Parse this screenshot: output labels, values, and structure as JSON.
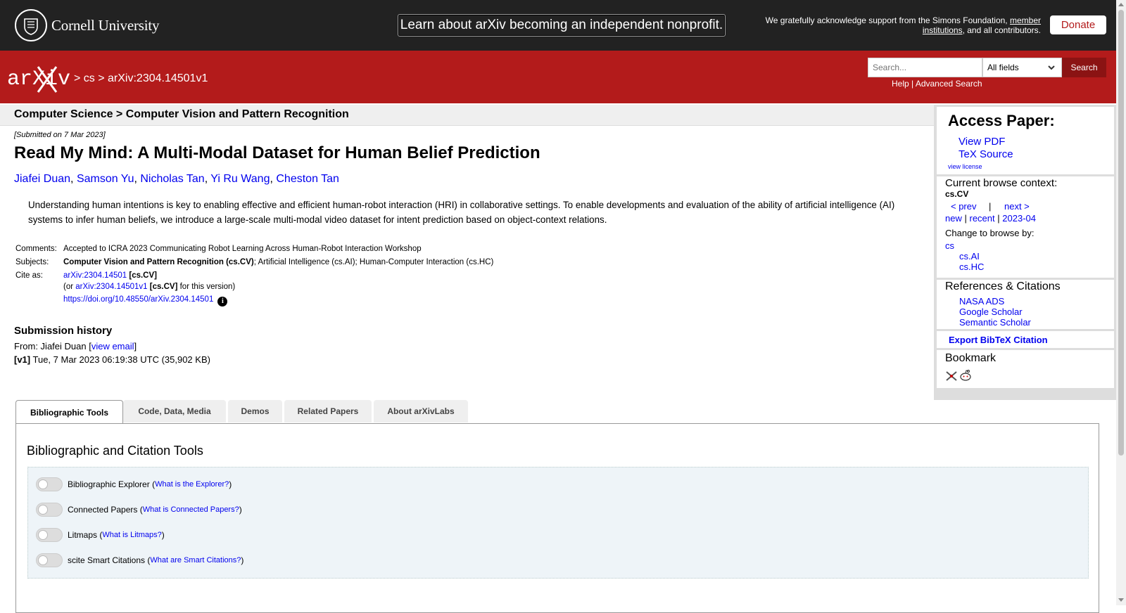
{
  "top": {
    "institution": "Cornell University",
    "banner": "Learn about arXiv becoming an independent nonprofit.",
    "support_prefix": "We gratefully acknowledge support from the Simons Foundation,",
    "support_link": "member institutions",
    "support_suffix": ", and all contributors.",
    "donate": "Donate"
  },
  "header": {
    "logo_text": "arXiv",
    "breadcrumb": "> cs > arXiv:2304.14501v1",
    "search_placeholder": "Search...",
    "field_selected": "All fields",
    "search_button": "Search",
    "help": "Help",
    "separator": "|",
    "advanced": "Advanced Search"
  },
  "subject_header": "Computer Science > Computer Vision and Pattern Recognition",
  "paper": {
    "submitted": "[Submitted on 7 Mar 2023]",
    "title": "Read My Mind: A Multi-Modal Dataset for Human Belief Prediction",
    "authors": [
      "Jiafei Duan",
      "Samson Yu",
      "Nicholas Tan",
      "Yi Ru Wang",
      "Cheston Tan"
    ],
    "abstract": "Understanding human intentions is key to enabling effective and efficient human-robot interaction (HRI) in collaborative settings. To enable developments and evaluation of the ability of artificial intelligence (AI) systems to infer human beliefs, we introduce a large-scale multi-modal video dataset for intent prediction based on object-context relations."
  },
  "meta": {
    "comments_label": "Comments:",
    "comments": "Accepted to ICRA 2023 Communicating Robot Learning Across Human-Robot Interaction Workshop",
    "subjects_label": "Subjects:",
    "subjects_primary": "Computer Vision and Pattern Recognition (cs.CV)",
    "subjects_rest": "; Artificial Intelligence (cs.AI); Human-Computer Interaction (cs.HC)",
    "cite_label": "Cite as:",
    "cite_id": "arXiv:2304.14501",
    "cite_tag": "[cs.CV]",
    "cite_or": "(or",
    "cite_version_id": "arXiv:2304.14501v1",
    "cite_version_tag": "[cs.CV]",
    "cite_version_suffix": "for this version)",
    "doi": "https://doi.org/10.48550/arXiv.2304.14501",
    "info_glyph": "i"
  },
  "history": {
    "title": "Submission history",
    "from_label": "From: Jiafei Duan [",
    "view_email": "view email",
    "from_close": "]",
    "v1_tag": "[v1]",
    "v1_text": "Tue, 7 Mar 2023 06:19:38 UTC (35,902 KB)"
  },
  "sidebar": {
    "access_title": "Access Paper:",
    "view_pdf": "View PDF",
    "tex_source": "TeX Source",
    "view_license": "view license",
    "browse_title": "Current browse context:",
    "browse_context": "cs.CV",
    "prev": "< prev",
    "pipe": "|",
    "next": "next >",
    "new": "new",
    "recent": "recent",
    "month": "2023-04",
    "change_browse": "Change to browse by:",
    "cs": "cs",
    "cs_ai": "cs.AI",
    "cs_hc": "cs.HC",
    "refs_title": "References & Citations",
    "nasa": "NASA ADS",
    "google": "Google Scholar",
    "semantic": "Semantic Scholar",
    "export": "Export BibTeX Citation",
    "bookmark": "Bookmark"
  },
  "tabs": [
    "Bibliographic Tools",
    "Code, Data, Media",
    "Demos",
    "Related Papers",
    "About arXivLabs"
  ],
  "panel": {
    "title": "Bibliographic and Citation Tools",
    "tools": [
      {
        "label": "Bibliographic Explorer",
        "help": "What is the Explorer?"
      },
      {
        "label": "Connected Papers",
        "help": "What is Connected Papers?"
      },
      {
        "label": "Litmaps",
        "help": "What is Litmaps?"
      },
      {
        "label": "scite Smart Citations",
        "help": "What are Smart Citations?"
      }
    ]
  },
  "colors": {
    "arxiv_red": "#b31b1b",
    "link_blue": "#0000ee",
    "topbar": "#222222"
  }
}
